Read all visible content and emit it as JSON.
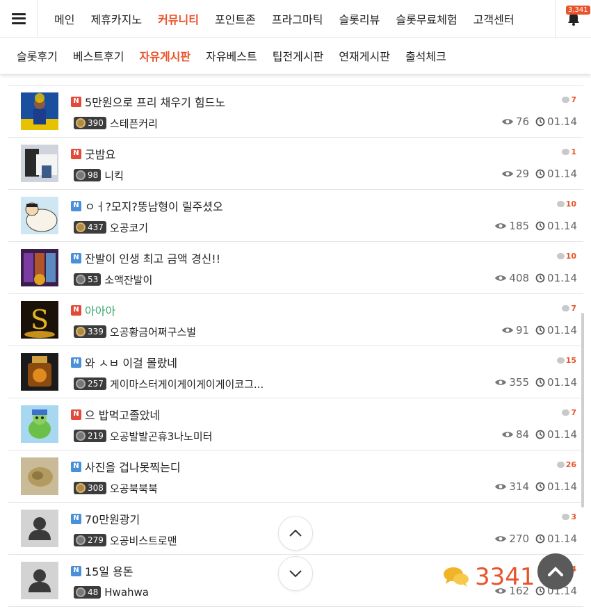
{
  "nav": {
    "items": [
      "메인",
      "제휴카지노",
      "커뮤니티",
      "포인트존",
      "프라그마틱",
      "슬롯리뷰",
      "슬롯무료체험",
      "고객센터"
    ],
    "active_index": 2,
    "notification_count": "3,341"
  },
  "subnav": {
    "items": [
      "슬롯후기",
      "베스트후기",
      "자유게시판",
      "자유베스트",
      "팁전게시판",
      "연재게시판",
      "출석체크"
    ],
    "active_index": 2
  },
  "posts": [
    {
      "tag": "N",
      "tag_color": "red",
      "title": "5만원으로 프리 채우기 힘드노",
      "title_color": "default",
      "comments": "7",
      "level": "390",
      "author": "스테픈커리",
      "views": "76",
      "date": "01.14",
      "thumb": "thumb-curry"
    },
    {
      "tag": "N",
      "tag_color": "red",
      "title": "굿밤요",
      "title_color": "default",
      "comments": "1",
      "level": "98",
      "author": "니킥",
      "views": "29",
      "date": "01.14",
      "thumb": "thumb-kick"
    },
    {
      "tag": "N",
      "tag_color": "blue",
      "title": "ㅇㅓ?모지?뚱남형이 릴주셨오",
      "title_color": "default",
      "comments": "10",
      "level": "437",
      "author": "오공코기",
      "views": "185",
      "date": "01.14",
      "thumb": "thumb-shin"
    },
    {
      "tag": "N",
      "tag_color": "blue",
      "title": "잔발이 인생 최고 금액 경신!!",
      "title_color": "default",
      "comments": "10",
      "level": "53",
      "author": "소액잔발이",
      "views": "408",
      "date": "01.14",
      "thumb": "thumb-slot"
    },
    {
      "tag": "N",
      "tag_color": "red",
      "title": "아아아",
      "title_color": "green",
      "comments": "7",
      "level": "339",
      "author": "오공황금어쩌구스벌",
      "views": "91",
      "date": "01.14",
      "thumb": "thumb-gold"
    },
    {
      "tag": "N",
      "tag_color": "blue",
      "title": "와 ㅅㅂ 이걸 몰랐네",
      "title_color": "default",
      "comments": "15",
      "level": "257",
      "author": "게이마스터게이게이게이게이코그...",
      "views": "355",
      "date": "01.14",
      "thumb": "thumb-cards"
    },
    {
      "tag": "N",
      "tag_color": "red",
      "title": "으 밥먹고졸았네",
      "title_color": "default",
      "comments": "7",
      "level": "219",
      "author": "오공발발곤휴3나노미터",
      "views": "84",
      "date": "01.14",
      "thumb": "thumb-turtle"
    },
    {
      "tag": "N",
      "tag_color": "blue",
      "title": "사진을 겁나못찍는디",
      "title_color": "default",
      "comments": "26",
      "level": "308",
      "author": "오공북북북",
      "views": "314",
      "date": "01.14",
      "thumb": "thumb-food"
    },
    {
      "tag": "N",
      "tag_color": "blue",
      "title": "70만원광기",
      "title_color": "default",
      "comments": "3",
      "level": "279",
      "author": "오공비스트로맨",
      "views": "270",
      "date": "01.14",
      "thumb": "thumb-default"
    },
    {
      "tag": "N",
      "tag_color": "blue",
      "title": "15일 용돈",
      "title_color": "default",
      "comments": "4",
      "level": "48",
      "author": "Hwahwa",
      "views": "162",
      "date": "01.14",
      "thumb": "thumb-default"
    }
  ],
  "chat": {
    "count": "3341"
  },
  "colors": {
    "accent": "#e8532a",
    "tag_red": "#e14b3b",
    "tag_blue": "#4a90d9",
    "green_title": "#3aa66a"
  }
}
